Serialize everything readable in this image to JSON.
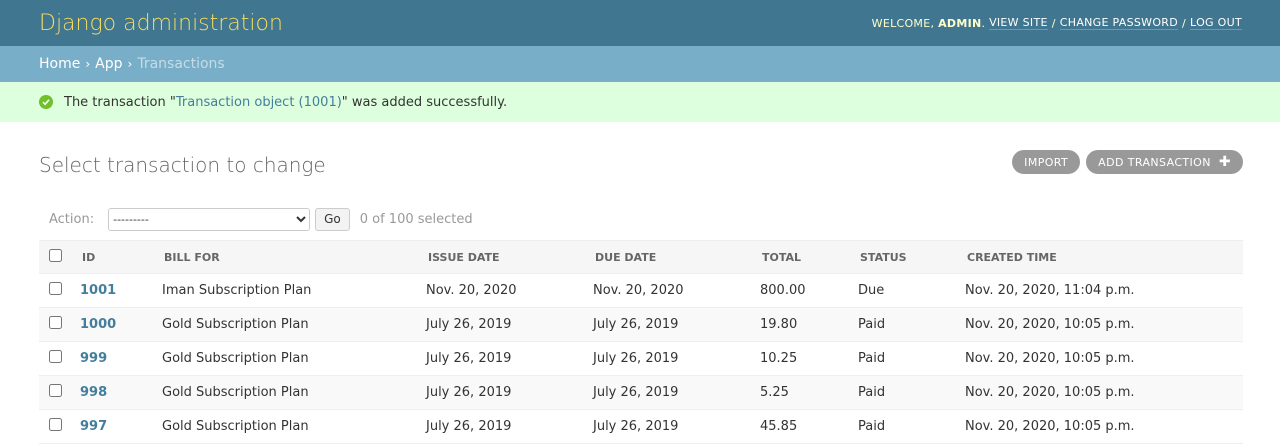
{
  "header": {
    "branding": "Django administration",
    "welcome": "Welcome,",
    "username": "admin",
    "view_site": "View site",
    "change_password": "Change password",
    "log_out": "Log out",
    "separator": "/"
  },
  "breadcrumbs": {
    "home": "Home",
    "app": "App",
    "current": "Transactions",
    "separator": "›"
  },
  "message": {
    "prefix": "The transaction \"",
    "link": "Transaction object (1001)",
    "suffix": "\" was added successfully."
  },
  "content": {
    "title": "Select transaction to change",
    "import_label": "Import",
    "add_label": "Add transaction",
    "add_icon": "plus-icon"
  },
  "actions": {
    "label": "Action:",
    "selected_option": "---------",
    "go_label": "Go",
    "counter": "0 of 100 selected"
  },
  "table": {
    "headers": [
      "ID",
      "Bill for",
      "Issue date",
      "Due date",
      "Total",
      "Status",
      "Created time"
    ],
    "rows": [
      {
        "id": "1001",
        "bill_for": "Iman Subscription Plan",
        "issue_date": "Nov. 20, 2020",
        "due_date": "Nov. 20, 2020",
        "total": "800.00",
        "status": "Due",
        "created": "Nov. 20, 2020, 11:04 p.m."
      },
      {
        "id": "1000",
        "bill_for": "Gold Subscription Plan",
        "issue_date": "July 26, 2019",
        "due_date": "July 26, 2019",
        "total": "19.80",
        "status": "Paid",
        "created": "Nov. 20, 2020, 10:05 p.m."
      },
      {
        "id": "999",
        "bill_for": "Gold Subscription Plan",
        "issue_date": "July 26, 2019",
        "due_date": "July 26, 2019",
        "total": "10.25",
        "status": "Paid",
        "created": "Nov. 20, 2020, 10:05 p.m."
      },
      {
        "id": "998",
        "bill_for": "Gold Subscription Plan",
        "issue_date": "July 26, 2019",
        "due_date": "July 26, 2019",
        "total": "5.25",
        "status": "Paid",
        "created": "Nov. 20, 2020, 10:05 p.m."
      },
      {
        "id": "997",
        "bill_for": "Gold Subscription Plan",
        "issue_date": "July 26, 2019",
        "due_date": "July 26, 2019",
        "total": "45.85",
        "status": "Paid",
        "created": "Nov. 20, 2020, 10:05 p.m."
      }
    ]
  },
  "colors": {
    "header_bg": "#417690",
    "branding": "#f5dd5d",
    "breadcrumbs_bg": "#79aec8",
    "message_bg": "#ddffdd",
    "success_icon": "#70bf2b",
    "link": "#447e9b",
    "button_bg": "#999999"
  }
}
